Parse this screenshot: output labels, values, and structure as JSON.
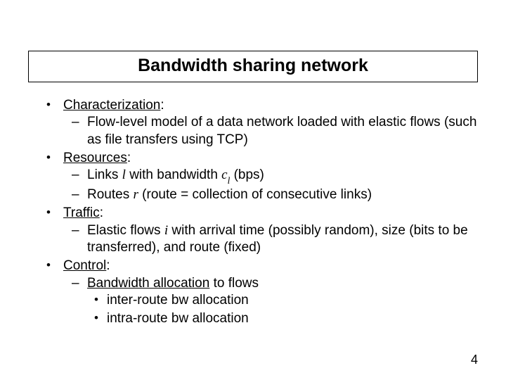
{
  "title": "Bandwidth sharing network",
  "b0": {
    "label": "Characterization",
    "sub0": "Flow-level model of a data network loaded with elastic flows (such as file transfers using TCP)"
  },
  "b1": {
    "label": "Resources",
    "sub0_pre": "Links ",
    "sub0_var": "l",
    "sub0_mid": " with bandwidth ",
    "sub0_c": "c",
    "sub0_csub": "l",
    "sub0_post": " (bps)",
    "sub1_pre": "Routes ",
    "sub1_var": "r",
    "sub1_post": " (route = collection of consecutive links)"
  },
  "b2": {
    "label": "Traffic",
    "sub0_pre": "Elastic flows ",
    "sub0_var": "i",
    "sub0_post": " with arrival time (possibly random), size (bits to be transferred), and route (fixed)"
  },
  "b3": {
    "label": "Control",
    "sub0": "Bandwidth allocation",
    "sub0_after": " to flows",
    "subsub0": "inter-route bw allocation",
    "subsub1": "intra-route bw allocation"
  },
  "colon": ":",
  "pagenum": "4"
}
